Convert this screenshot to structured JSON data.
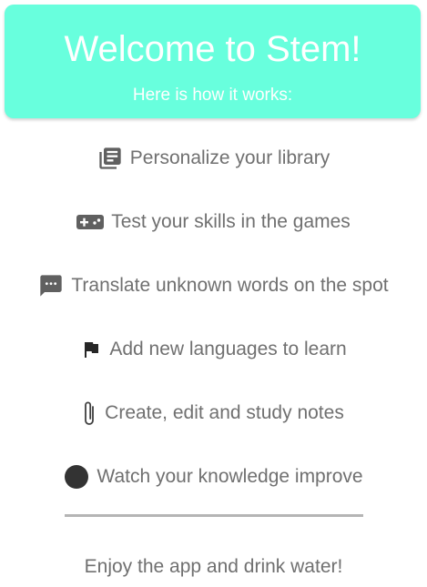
{
  "header": {
    "title": "Welcome to Stem!",
    "subtitle": "Here is how it works:",
    "background_color": "#68ffdd"
  },
  "features": [
    {
      "icon": "library-books-icon",
      "label": "Personalize your library"
    },
    {
      "icon": "gamepad-icon",
      "label": "Test your skills in the games"
    },
    {
      "icon": "chat-bubble-icon",
      "label": "Translate unknown words on the spot"
    },
    {
      "icon": "flag-icon",
      "label": "Add new languages to learn"
    },
    {
      "icon": "paperclip-icon",
      "label": "Create, edit and study notes"
    },
    {
      "icon": "circle-icon",
      "label": "Watch your knowledge improve"
    }
  ],
  "footer": {
    "text": "Enjoy the app and drink water!"
  }
}
